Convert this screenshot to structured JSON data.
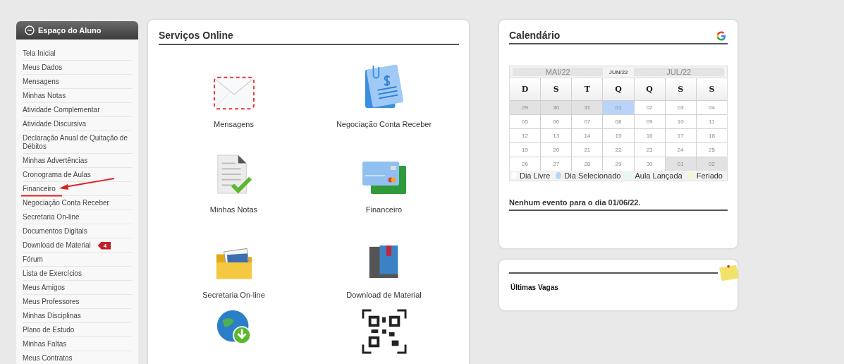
{
  "sidebar": {
    "title": "Espaço do Aluno",
    "items": [
      {
        "label": "Tela Inicial"
      },
      {
        "label": "Meus Dados"
      },
      {
        "label": "Mensagens"
      },
      {
        "label": "Minhas Notas"
      },
      {
        "label": "Atividade Complementar"
      },
      {
        "label": "Atividade Discursiva"
      },
      {
        "label": "Declaração Anual de Quitação de Débitos"
      },
      {
        "label": "Minhas Advertências"
      },
      {
        "label": "Cronograma de Aulas"
      },
      {
        "label": "Financeiro",
        "annotated": true
      },
      {
        "label": "Negociação Conta Receber"
      },
      {
        "label": "Secretaria On-line"
      },
      {
        "label": "Documentos Digitais"
      },
      {
        "label": "Download de Material",
        "badge": "4"
      },
      {
        "label": "Fórum"
      },
      {
        "label": "Lista de Exercícios"
      },
      {
        "label": "Meus Amigos"
      },
      {
        "label": "Meus Professores"
      },
      {
        "label": "Minhas Disciplinas"
      },
      {
        "label": "Plano de Estudo"
      },
      {
        "label": "Minhas Faltas"
      },
      {
        "label": "Meus Contratos"
      }
    ]
  },
  "services": {
    "title": "Serviços Online",
    "items": [
      {
        "label": "Mensagens",
        "kind": "envelope"
      },
      {
        "label": "Negociação Conta Receber",
        "kind": "invoice"
      },
      {
        "label": "Minhas Notas",
        "kind": "document"
      },
      {
        "label": "Financeiro",
        "kind": "cards"
      },
      {
        "label": "Secretaria On-line",
        "kind": "folder"
      },
      {
        "label": "Download de Material",
        "kind": "books"
      },
      {
        "kind": "globe"
      },
      {
        "kind": "qr"
      }
    ]
  },
  "calendar": {
    "title": "Calendário",
    "prev_month": "MAI/22",
    "current_month": "JUN/22",
    "next_month": "JUL/22",
    "weekdays": [
      "D",
      "S",
      "T",
      "Q",
      "Q",
      "S",
      "S"
    ],
    "weeks": [
      [
        {
          "day": "29",
          "kind": "other"
        },
        {
          "day": "30",
          "kind": "other"
        },
        {
          "day": "31",
          "kind": "other"
        },
        {
          "day": "01",
          "kind": "selected"
        },
        {
          "day": "02",
          "kind": "free"
        },
        {
          "day": "03",
          "kind": "free"
        },
        {
          "day": "04",
          "kind": "free"
        }
      ],
      [
        {
          "day": "05",
          "kind": "free"
        },
        {
          "day": "06",
          "kind": "free"
        },
        {
          "day": "07",
          "kind": "free"
        },
        {
          "day": "08",
          "kind": "free"
        },
        {
          "day": "09",
          "kind": "free"
        },
        {
          "day": "10",
          "kind": "free"
        },
        {
          "day": "11",
          "kind": "free"
        }
      ],
      [
        {
          "day": "12",
          "kind": "free"
        },
        {
          "day": "13",
          "kind": "free"
        },
        {
          "day": "14",
          "kind": "free"
        },
        {
          "day": "15",
          "kind": "free"
        },
        {
          "day": "16",
          "kind": "free"
        },
        {
          "day": "17",
          "kind": "free"
        },
        {
          "day": "18",
          "kind": "free"
        }
      ],
      [
        {
          "day": "19",
          "kind": "free"
        },
        {
          "day": "20",
          "kind": "free"
        },
        {
          "day": "21",
          "kind": "free"
        },
        {
          "day": "22",
          "kind": "free"
        },
        {
          "day": "23",
          "kind": "free"
        },
        {
          "day": "24",
          "kind": "free"
        },
        {
          "day": "25",
          "kind": "free"
        }
      ],
      [
        {
          "day": "26",
          "kind": "free"
        },
        {
          "day": "27",
          "kind": "free"
        },
        {
          "day": "28",
          "kind": "free"
        },
        {
          "day": "29",
          "kind": "free"
        },
        {
          "day": "30",
          "kind": "free"
        },
        {
          "day": "01",
          "kind": "other"
        },
        {
          "day": "02",
          "kind": "other"
        }
      ]
    ],
    "legend": [
      {
        "label": "Dia Livre",
        "color": "#ffffff"
      },
      {
        "label": "Dia Selecionado",
        "color": "#b8d4f8"
      },
      {
        "label": "Aula Lançada",
        "color": "#e0fafa"
      },
      {
        "label": "Feriado",
        "color": "#f8f4cc"
      }
    ],
    "events_message": "Nenhum evento para o dia 01/06/22."
  },
  "vacancies": {
    "title": "Últimas Vagas"
  }
}
